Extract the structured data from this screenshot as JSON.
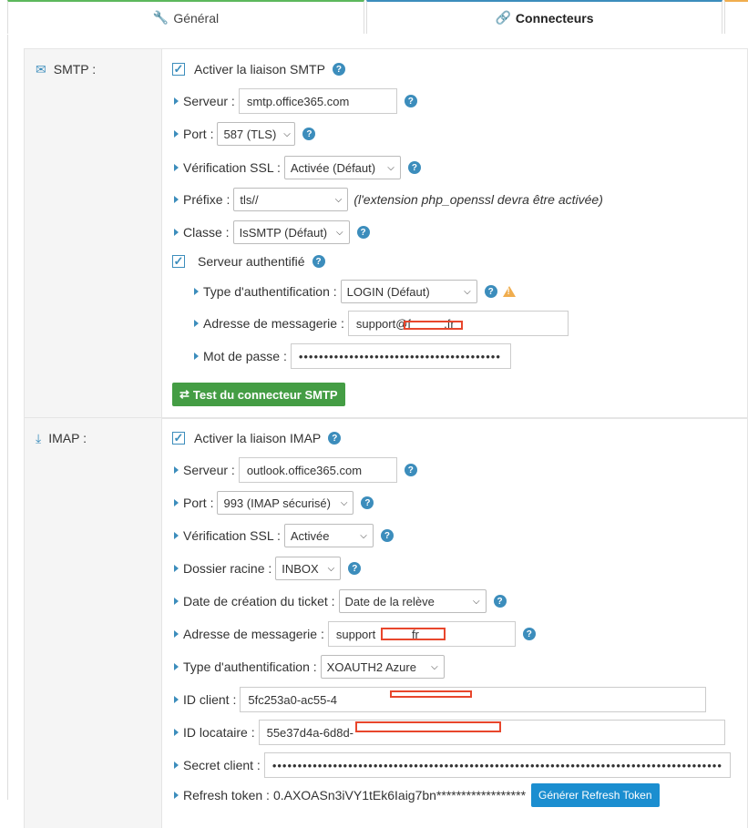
{
  "tabs": {
    "general": "Général",
    "connecteurs": "Connecteurs"
  },
  "smtp": {
    "label": "SMTP :",
    "enable": "Activer la liaison SMTP",
    "server_label": "Serveur :",
    "server_value": "smtp.office365.com",
    "port_label": "Port :",
    "port_value": "587 (TLS)",
    "ssl_label": "Vérification SSL :",
    "ssl_value": "Activée (Défaut)",
    "prefix_label": "Préfixe :",
    "prefix_value": "tls//",
    "prefix_note": "(l'extension php_openssl devra être activée)",
    "class_label": "Classe :",
    "class_value": "IsSMTP (Défaut)",
    "auth_server": "Serveur authentifié",
    "auth_type_label": "Type d'authentification :",
    "auth_type_value": "LOGIN (Défaut)",
    "email_label": "Adresse de messagerie :",
    "email_value": "support@f          .fr",
    "password_label": "Mot de passe :",
    "password_value": "••••••••••••••••••••••••••••••••••••••••",
    "test_button": "Test du connecteur SMTP"
  },
  "imap": {
    "label": "IMAP :",
    "enable": "Activer la liaison IMAP",
    "server_label": "Serveur :",
    "server_value": "outlook.office365.com",
    "port_label": "Port :",
    "port_value": "993 (IMAP sécurisé)",
    "ssl_label": "Vérification SSL :",
    "ssl_value": "Activée",
    "folder_label": "Dossier racine :",
    "folder_value": "INBOX",
    "date_label": "Date de création du ticket :",
    "date_value": "Date de la relève",
    "email_label": "Adresse de messagerie :",
    "email_value": "support           fr",
    "auth_type_label": "Type d'authentification :",
    "auth_type_value": "XOAUTH2 Azure",
    "client_id_label": "ID client :",
    "client_id_value": "5fc253a0-ac55-4",
    "tenant_id_label": "ID locataire :",
    "tenant_id_value": "55e37d4a-6d8d-",
    "secret_label": "Secret client :",
    "secret_value": "••••••••••••••••••••••••••••••••••••••••••••••••••••••••••••••••••••••••••••••••••••••••••••",
    "refresh_label": "Refresh token :",
    "refresh_value": "0.AXOASn3iVY1tEk6Iaig7bn******************",
    "refresh_button": "Générer Refresh Token"
  }
}
